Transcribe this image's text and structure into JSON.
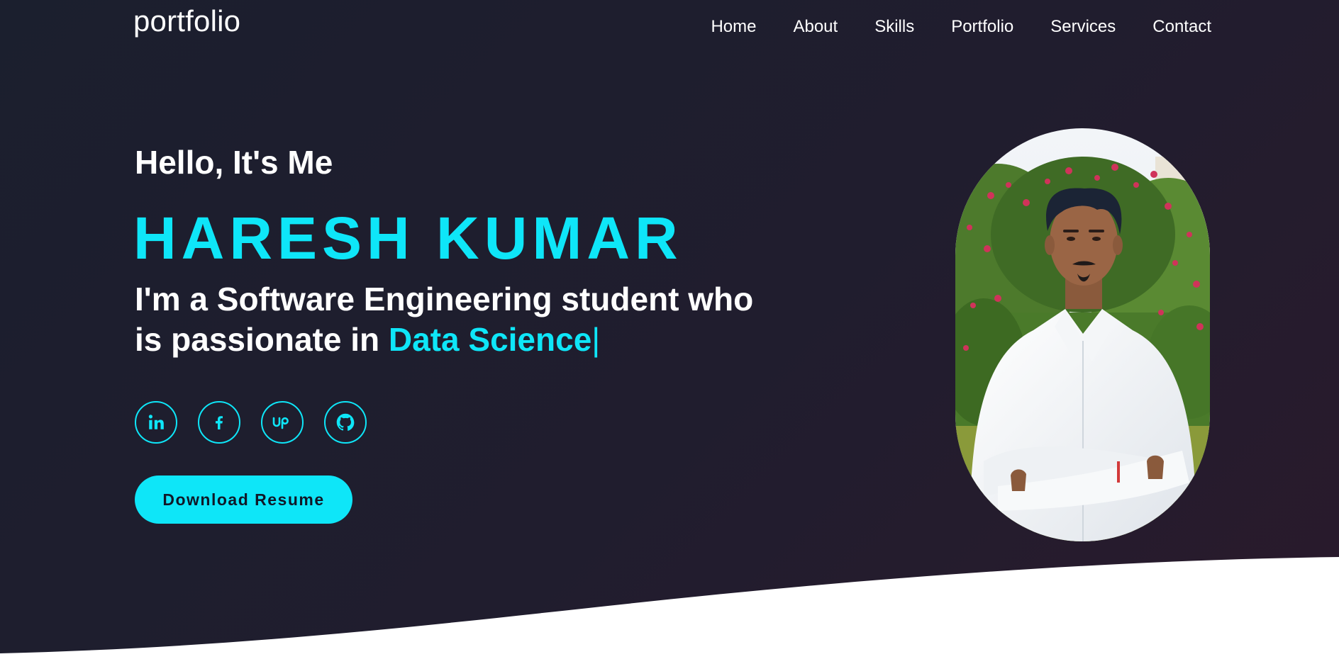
{
  "logo": "portfolio",
  "nav": {
    "items": [
      {
        "label": "Home"
      },
      {
        "label": "About"
      },
      {
        "label": "Skills"
      },
      {
        "label": "Portfolio"
      },
      {
        "label": "Services"
      },
      {
        "label": "Contact"
      }
    ]
  },
  "hero": {
    "greeting": "Hello, It's Me",
    "name": "HARESH KUMAR",
    "tagline_prefix": "I'm a Software Engineering student who is passionate in",
    "typed_text": "Data Science",
    "caret": "|",
    "download_label": "Download Resume"
  },
  "socials": [
    {
      "icon": "linkedin-icon"
    },
    {
      "icon": "facebook-icon"
    },
    {
      "icon": "upwork-icon"
    },
    {
      "icon": "github-icon"
    }
  ],
  "theme": {
    "accent": "#0ee6f8",
    "background": "#1e1e2e",
    "text": "#ffffff"
  }
}
